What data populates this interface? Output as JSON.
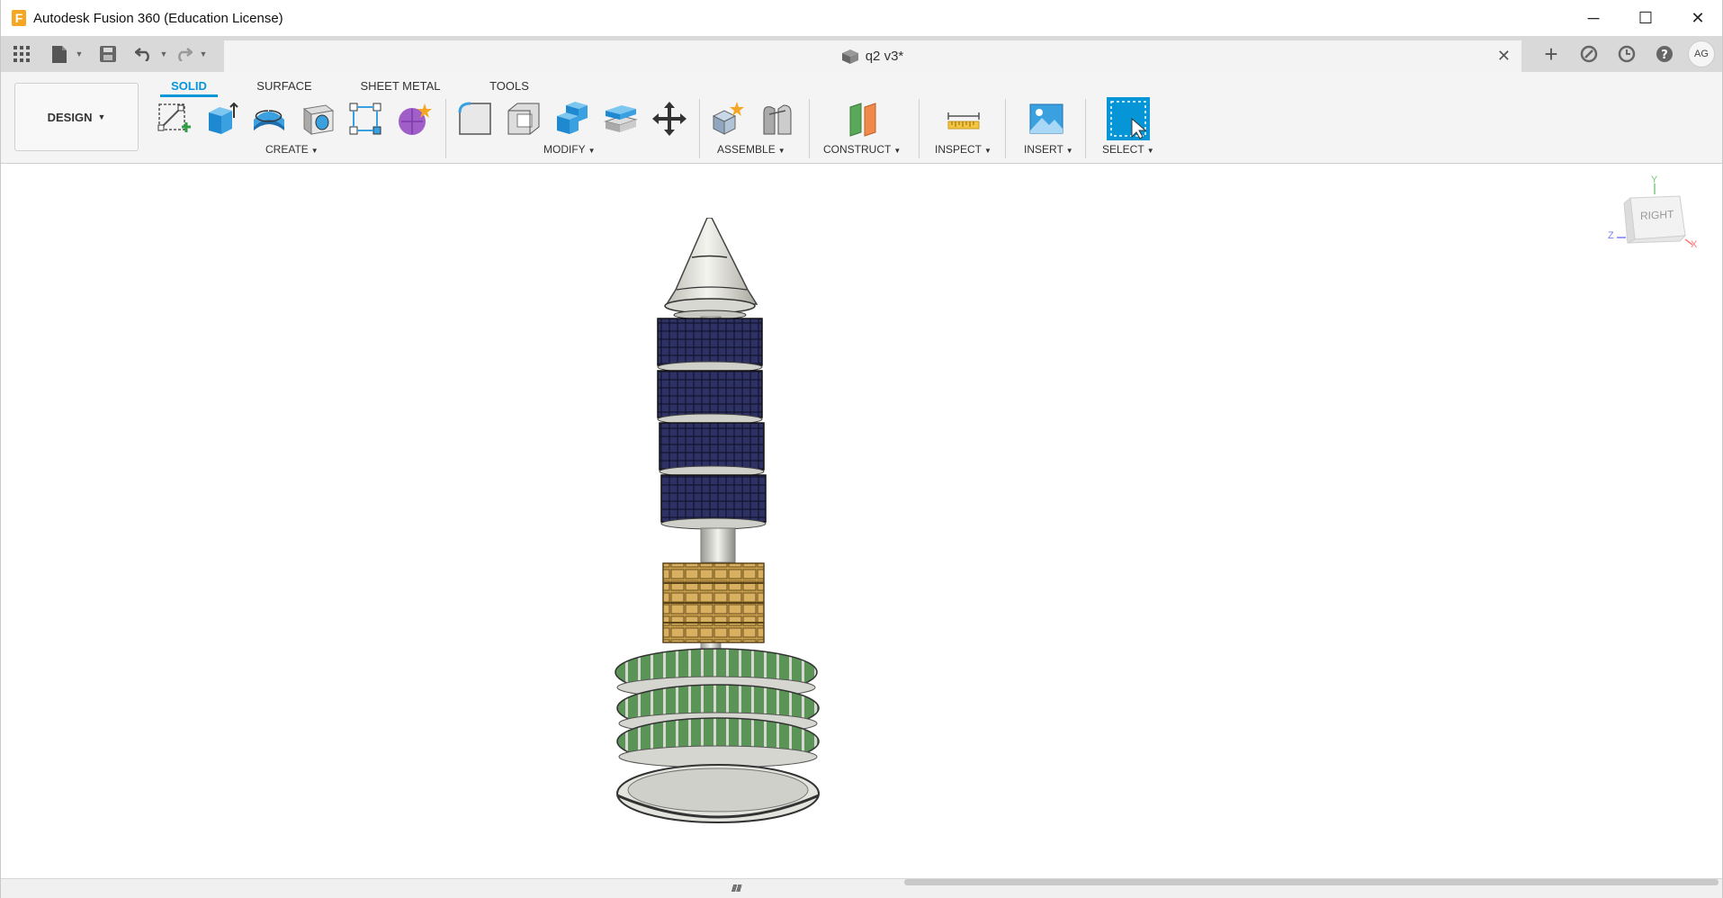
{
  "window": {
    "title": "Autodesk Fusion 360 (Education License)",
    "logo_letter": "F",
    "minimize": "─",
    "maximize": "☐",
    "close": "✕"
  },
  "quick_access": {
    "document_tab_title": "q2 v3*",
    "document_tab_close": "✕",
    "user_initials": "AG"
  },
  "workspace": {
    "label": "DESIGN"
  },
  "tabs": [
    {
      "label": "SOLID",
      "active": true
    },
    {
      "label": "SURFACE",
      "active": false
    },
    {
      "label": "SHEET METAL",
      "active": false
    },
    {
      "label": "TOOLS",
      "active": false
    }
  ],
  "groups": {
    "create": "CREATE",
    "modify": "MODIFY",
    "assemble": "ASSEMBLE",
    "construct": "CONSTRUCT",
    "inspect": "INSPECT",
    "insert": "INSERT",
    "select": "SELECT"
  },
  "viewcube": {
    "face_label": "RIGHT",
    "axis_y": "Y",
    "axis_z": "Z",
    "axis_x": "X"
  },
  "colors": {
    "accent": "#0696d7",
    "solar_panel": "#2b2f5e",
    "gold": "#c8a048",
    "green_disc": "#4f8a4a"
  }
}
